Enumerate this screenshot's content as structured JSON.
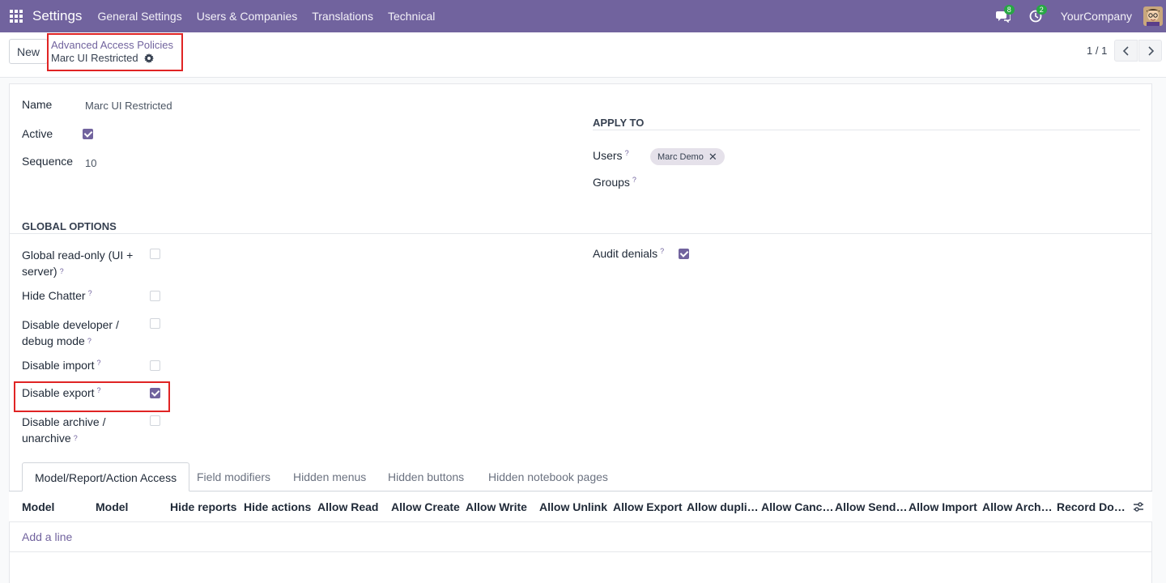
{
  "navbar": {
    "brand": "Settings",
    "menus": [
      "General Settings",
      "Users & Companies",
      "Translations",
      "Technical"
    ],
    "messages_badge": "8",
    "activity_badge": "2",
    "company": "YourCompany"
  },
  "control_panel": {
    "new_button": "New",
    "breadcrumb_parent": "Advanced Access Policies",
    "breadcrumb_current": "Marc UI Restricted",
    "pager": "1 / 1"
  },
  "form": {
    "name_label": "Name",
    "name_value": "Marc UI Restricted",
    "active_label": "Active",
    "active_checked": true,
    "sequence_label": "Sequence",
    "sequence_value": "10",
    "apply_to_title": "APPLY TO",
    "users_label": "Users",
    "users_tag": "Marc Demo",
    "groups_label": "Groups",
    "global_options_title": "GLOBAL OPTIONS",
    "options": [
      {
        "label_line1": "Global read-only (UI +",
        "label_line2": "server)",
        "checked": false
      },
      {
        "label_line1": "Hide Chatter",
        "label_line2": "",
        "checked": false
      },
      {
        "label_line1": "Disable developer /",
        "label_line2": "debug mode",
        "checked": false
      },
      {
        "label_line1": "Disable import",
        "label_line2": "",
        "checked": false
      },
      {
        "label_line1": "Disable export",
        "label_line2": "",
        "checked": true
      },
      {
        "label_line1": "Disable archive /",
        "label_line2": "unarchive",
        "checked": false
      }
    ],
    "audit_label": "Audit denials",
    "audit_checked": true,
    "help_mark": "?"
  },
  "tabs": [
    "Model/Report/Action Access",
    "Field modifiers",
    "Hidden menus",
    "Hidden buttons",
    "Hidden notebook pages"
  ],
  "table": {
    "columns": [
      "Model",
      "Model",
      "Hide reports",
      "Hide actions",
      "Allow Read",
      "Allow Create",
      "Allow Write",
      "Allow Unlink",
      "Allow Export",
      "Allow dupli…",
      "Allow Canc…",
      "Allow Send…",
      "Allow Import",
      "Allow Arch…",
      "Record Do…"
    ],
    "add_line": "Add a line"
  },
  "colors": {
    "navbar": "#71639e",
    "accent": "#71639e",
    "highlight_border": "#e02424"
  }
}
